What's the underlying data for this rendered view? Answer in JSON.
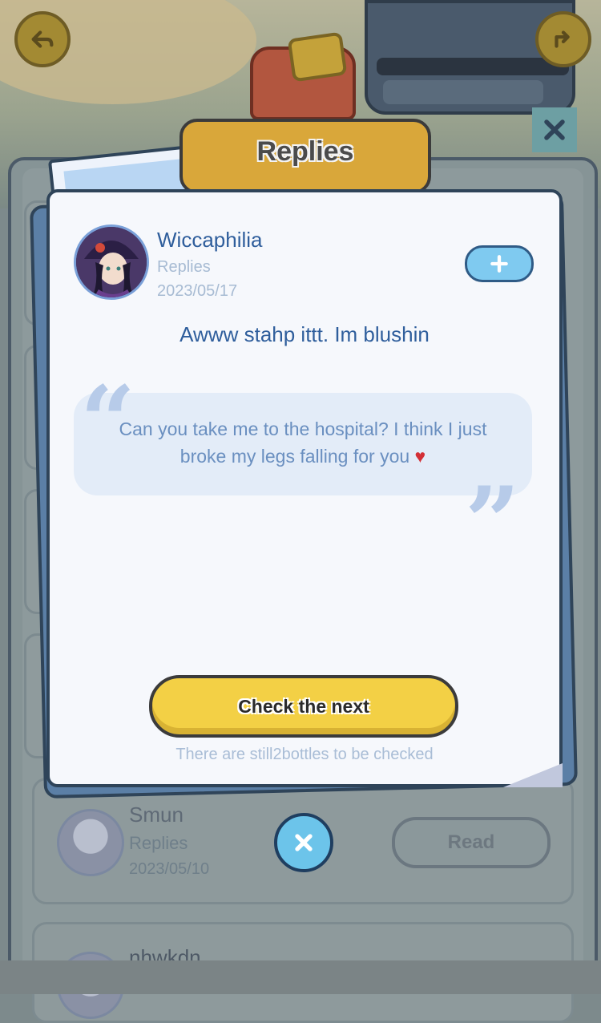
{
  "header": {
    "title": "Replies"
  },
  "message": {
    "user_name": "Wiccaphilia",
    "type_label": "Replies",
    "date": "2023/05/17",
    "reply": "Awww stahp ittt. Im blushin",
    "quote_line1": "Can you take me to the hospital? I think I just",
    "quote_line2": "broke my legs falling for you",
    "quote_emoji": "♥",
    "next_button": "Check the next",
    "remaining_text": "There are still2bottles to be checked"
  },
  "list": {
    "rows": [
      {
        "name": "Smun",
        "type": "Replies",
        "date": "2023/05/10",
        "action": "Read"
      },
      {
        "name": "nhwkdn"
      }
    ]
  },
  "icons": {
    "back": "back-arrow-icon",
    "share": "share-icon",
    "close": "close-icon",
    "add": "plus-icon",
    "mailbox": "mailbox-icon"
  },
  "colors": {
    "accent_blue": "#2f5e9c",
    "button_yellow": "#f3d045",
    "title_tab": "#d9a73a",
    "add_button": "#7fcaf0"
  }
}
